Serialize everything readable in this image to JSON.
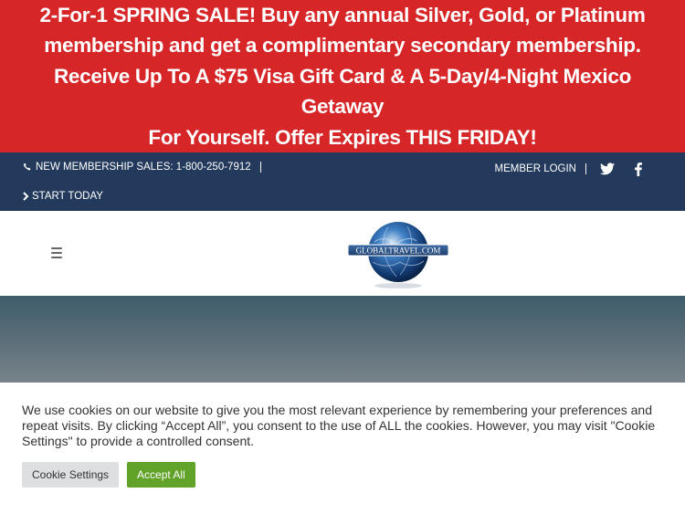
{
  "promo": {
    "text": "2-For-1  SPRING SALE! Buy any annual Silver, Gold, or Platinum\nmembership and get a complimentary secondary membership.\nReceive Up To A $75 Visa Gift Card & A 5-Day/4-Night Mexico Getaway\nFor Yourself. Offer Expires THIS FRIDAY!",
    "bg_color": "#d62628"
  },
  "topbar": {
    "phone_label": "NEW MEMBERSHIP SALES: 1-800-250-7912",
    "start_label": "START TODAY",
    "login_label": "MEMBER LOGIN",
    "icons": [
      "phone-icon",
      "chevron-right-icon",
      "twitter-icon",
      "facebook-icon"
    ],
    "bg_color": "#233a5c"
  },
  "header": {
    "logo_text": "GLOBALTRAVEL.COM",
    "menu_icon": "hamburger-icon"
  },
  "cookie": {
    "message": "We use cookies on our website to give you the most relevant experience by remembering your preferences and repeat visits. By clicking “Accept All”, you consent to the use of ALL the cookies. However, you may visit \"Cookie Settings\" to provide a controlled consent.",
    "settings_label": "Cookie Settings",
    "accept_label": "Accept All",
    "accept_color": "#61a229"
  }
}
